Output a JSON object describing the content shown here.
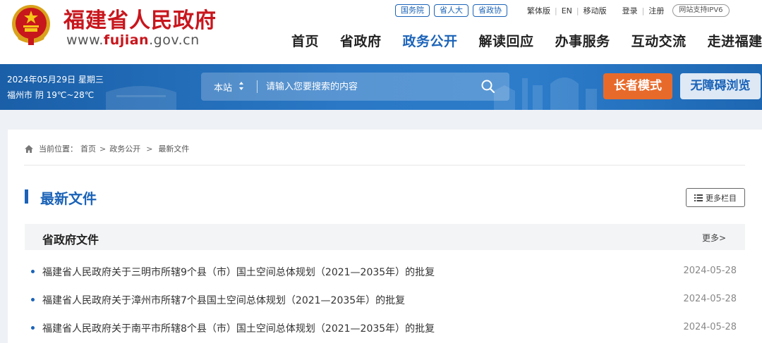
{
  "header": {
    "site_name": "福建省人民政府",
    "url_prefix": "www.",
    "url_domain": "fujian",
    "url_suffix": ".gov.cn",
    "top_links": {
      "state_council": "国务院",
      "npc": "省人大",
      "cppcc": "省政协",
      "traditional": "繁体版",
      "english": "EN",
      "mobile": "移动版",
      "login": "登录",
      "register": "注册",
      "ipv6": "网站支持IPV6"
    },
    "nav": [
      {
        "label": "首页"
      },
      {
        "label": "省政府"
      },
      {
        "label": "政务公开",
        "active": true
      },
      {
        "label": "解读回应"
      },
      {
        "label": "办事服务"
      },
      {
        "label": "互动交流"
      },
      {
        "label": "走进福建"
      }
    ]
  },
  "toolbar": {
    "date": "2024年05月29日 星期三",
    "weather": "福州市 阴 19℃~28℃",
    "search_scope": "本站",
    "search_placeholder": "请输入您要搜索的内容",
    "elder_mode": "长者模式",
    "accessible": "无障碍浏览"
  },
  "breadcrumb": {
    "label": "当前位置：",
    "items": [
      "首页",
      "政务公开",
      "最新文件"
    ],
    "sep": ">"
  },
  "section": {
    "title": "最新文件",
    "more_columns": "更多栏目"
  },
  "subsection": {
    "title": "省政府文件",
    "more": "更多>"
  },
  "articles": [
    {
      "title": "福建省人民政府关于三明市所辖9个县（市）国土空间总体规划（2021—2035年）的批复",
      "date": "2024-05-28"
    },
    {
      "title": "福建省人民政府关于漳州市所辖7个县国土空间总体规划（2021—2035年）的批复",
      "date": "2024-05-28"
    },
    {
      "title": "福建省人民政府关于南平市所辖8个县（市）国土空间总体规划（2021—2035年）的批复",
      "date": "2024-05-28"
    }
  ],
  "colors": {
    "brand_red": "#c8161d",
    "brand_blue": "#1b63b8",
    "elder_orange": "#e86a2a"
  }
}
